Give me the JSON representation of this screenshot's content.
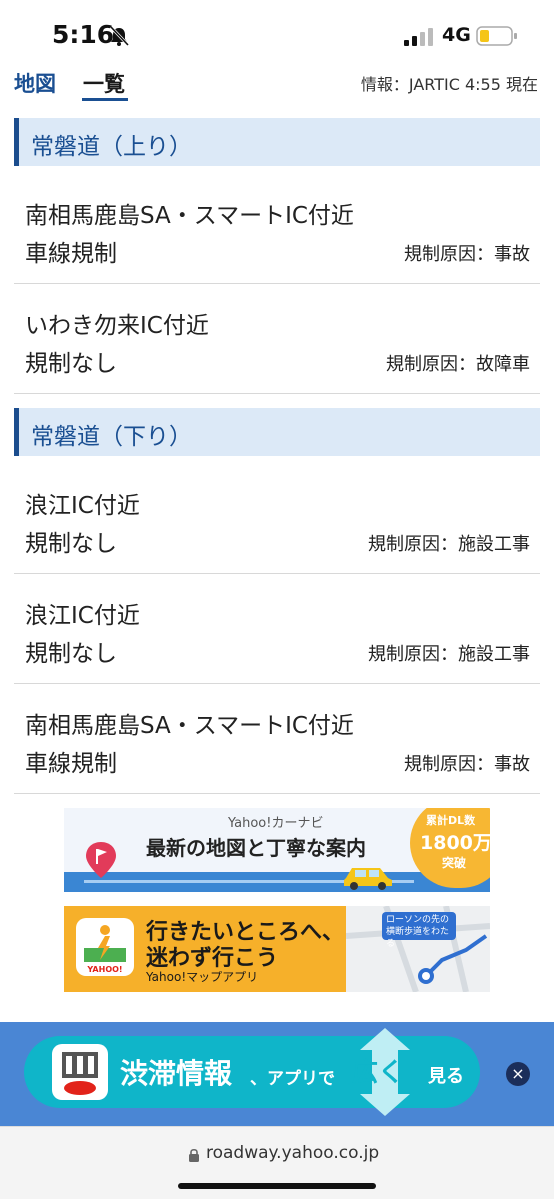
{
  "status_bar": {
    "time": "5:16",
    "network": "4G",
    "icons": [
      "bell-slash-icon",
      "signal-icon",
      "battery-icon"
    ]
  },
  "tabs": {
    "map": "地図",
    "list": "一覧",
    "active": "list"
  },
  "info": "情報：JARTIC 4:55 現在",
  "sections": [
    {
      "title": "常磐道（上り）",
      "items": [
        {
          "location": "南相馬鹿島SA・スマートIC付近",
          "status": "車線規制",
          "reason": "規制原因：事故"
        },
        {
          "location": "いわき勿来IC付近",
          "status": "規制なし",
          "reason": "規制原因：故障車"
        }
      ]
    },
    {
      "title": "常磐道（下り）",
      "items": [
        {
          "location": "浪江IC付近",
          "status": "規制なし",
          "reason": "規制原因：施設工事"
        },
        {
          "location": "浪江IC付近",
          "status": "規制なし",
          "reason": "規制原因：施設工事"
        },
        {
          "location": "南相馬鹿島SA・スマートIC付近",
          "status": "車線規制",
          "reason": "規制原因：事故"
        }
      ]
    }
  ],
  "banner_carnavi": {
    "brand": "Yahoo!カーナビ",
    "text": "最新の地図と丁寧な案内",
    "badge_line1": "累計DL数",
    "badge_line2": "1800万",
    "badge_line3": "突破"
  },
  "banner_map": {
    "line1": "行きたいところへ、",
    "line2": "迷わず行こう",
    "line3": "Yahoo!マップアプリ",
    "bubble": "ローソンの先の横断歩道をわたる",
    "icon_label": "YAHOO!"
  },
  "app_bar": {
    "main": "渋滞情報",
    "sub": "、アプリで",
    "big": "広く",
    "see": "見る",
    "close": "×"
  },
  "url": "roadway.yahoo.co.jp",
  "colors": {
    "brand_blue": "#1a4f92",
    "section_bg": "#dce9f7",
    "app_bar_bg": "#4a86d4",
    "pill_cyan": "#0fb5c9",
    "banner_orange": "#f6b02a"
  }
}
